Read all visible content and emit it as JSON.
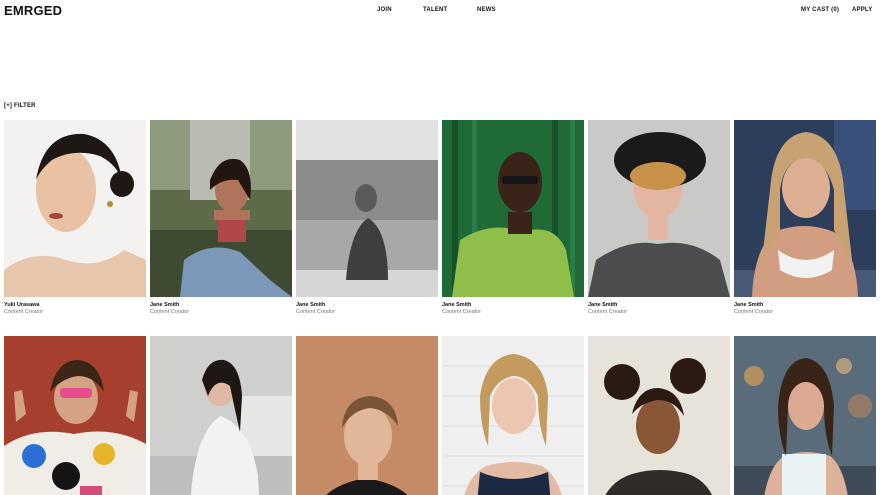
{
  "header": {
    "logo": "EMRGED",
    "nav": {
      "join": "JOIN",
      "talent": "TALENT",
      "news": "NEWS",
      "my_cast": "MY CAST (0)",
      "apply": "APPLY"
    }
  },
  "filter_label": "[+] FILTER",
  "talent": [
    {
      "name": "Yuki Urasawa",
      "role": "Content Creator"
    },
    {
      "name": "Jane Smith",
      "role": "Content Creator"
    },
    {
      "name": "Jane Smith",
      "role": "Content Creator"
    },
    {
      "name": "Jane Smith",
      "role": "Content Creator"
    },
    {
      "name": "Jane Smith",
      "role": "Content Creator"
    },
    {
      "name": "Jane Smith",
      "role": "Content Creator"
    },
    {
      "name": "",
      "role": ""
    },
    {
      "name": "",
      "role": ""
    },
    {
      "name": "",
      "role": ""
    },
    {
      "name": "",
      "role": ""
    },
    {
      "name": "",
      "role": ""
    },
    {
      "name": "",
      "role": ""
    }
  ]
}
